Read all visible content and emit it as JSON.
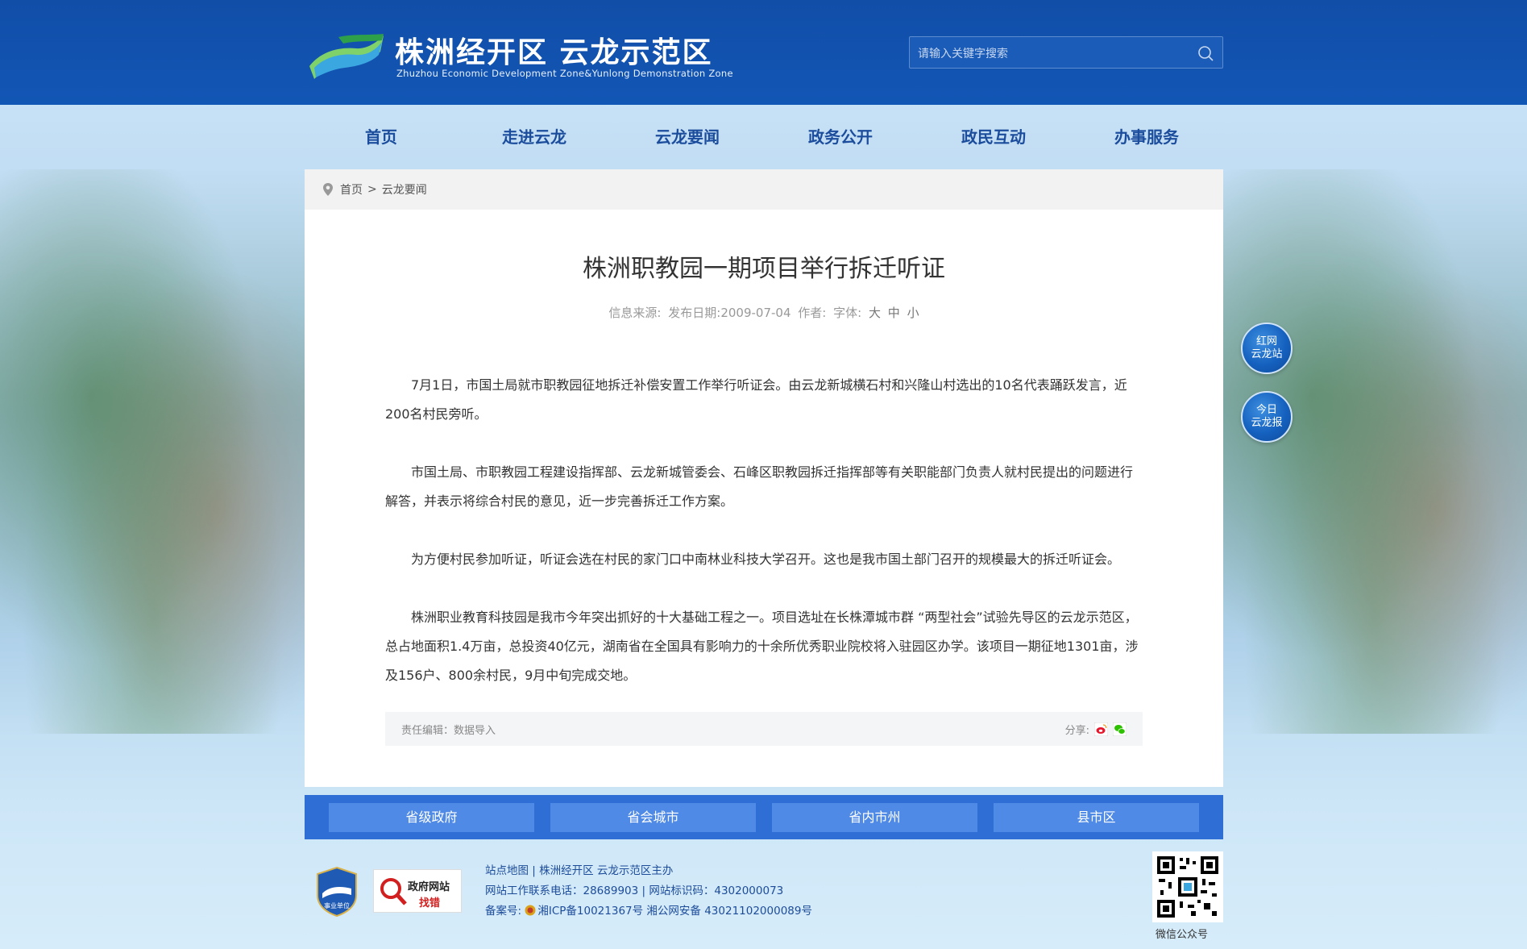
{
  "header": {
    "site_title": "株洲经开区 云龙示范区",
    "site_subtitle": "Zhuzhou Economic Development Zone&Yunlong Demonstration Zone",
    "search_placeholder": "请输入关键字搜索"
  },
  "nav": {
    "items": [
      {
        "label": "首页"
      },
      {
        "label": "走进云龙"
      },
      {
        "label": "云龙要闻"
      },
      {
        "label": "政务公开"
      },
      {
        "label": "政民互动"
      },
      {
        "label": "办事服务"
      }
    ]
  },
  "breadcrumb": {
    "home": "首页",
    "separator": ">",
    "current": "云龙要闻"
  },
  "article": {
    "title": "株洲职教园一期项目举行拆迁听证",
    "meta_source": "信息来源:",
    "meta_date": "发布日期:2009-07-04",
    "meta_author": "作者:",
    "meta_font": "字体:",
    "font_large": "大",
    "font_medium": "中",
    "font_small": "小",
    "paragraphs": [
      "7月1日，市国土局就市职教园征地拆迁补偿安置工作举行听证会。由云龙新城横石村和兴隆山村选出的10名代表踊跃发言，近200名村民旁听。",
      "市国土局、市职教园工程建设指挥部、云龙新城管委会、石峰区职教园拆迁指挥部等有关职能部门负责人就村民提出的问题进行解答，并表示将综合村民的意见，近一步完善拆迁工作方案。",
      "为方便村民参加听证，听证会选在村民的家门口中南林业科技大学召开。这也是我市国土部门召开的规模最大的拆迁听证会。",
      "株洲职业教育科技园是我市今年突出抓好的十大基础工程之一。项目选址在长株潭城市群 “两型社会”试验先导区的云龙示范区，总占地面积1.4万亩，总投资40亿元，湖南省在全国具有影响力的十余所优秀职业院校将入驻园区办学。该项目一期征地1301亩，涉及156户、800余村民，9月中旬完成交地。"
    ],
    "editor": "责任编辑：数据导入",
    "share_label": "分享:"
  },
  "links": {
    "items": [
      {
        "label": "省级政府"
      },
      {
        "label": "省会城市"
      },
      {
        "label": "省内市州"
      },
      {
        "label": "县市区"
      }
    ]
  },
  "footer": {
    "badge1_text": "事业单位",
    "badge2_line1": "政府网站",
    "badge2_line2": "找错",
    "sitemap": "站点地图",
    "sponsor": "株洲经开区 云龙示范区主办",
    "phone": "网站工作联系电话：28689903",
    "site_code": "网站标识码：4302000073",
    "icp_label": "备案号:",
    "icp": "湘ICP备10021367号",
    "police": "湘公网安备 43021102000089号",
    "qr_label": "微信公众号"
  },
  "floating": {
    "btn1": "红网\n云龙站",
    "btn1_line1": "红网",
    "btn1_line2": "云龙站",
    "btn2_line1": "今日",
    "btn2_line2": "云龙报"
  },
  "colors": {
    "header_bg": "#1256b5",
    "nav_text": "#1b4d9c",
    "links_bar": "#2f6fd5",
    "link_button": "#4f8ae6"
  }
}
